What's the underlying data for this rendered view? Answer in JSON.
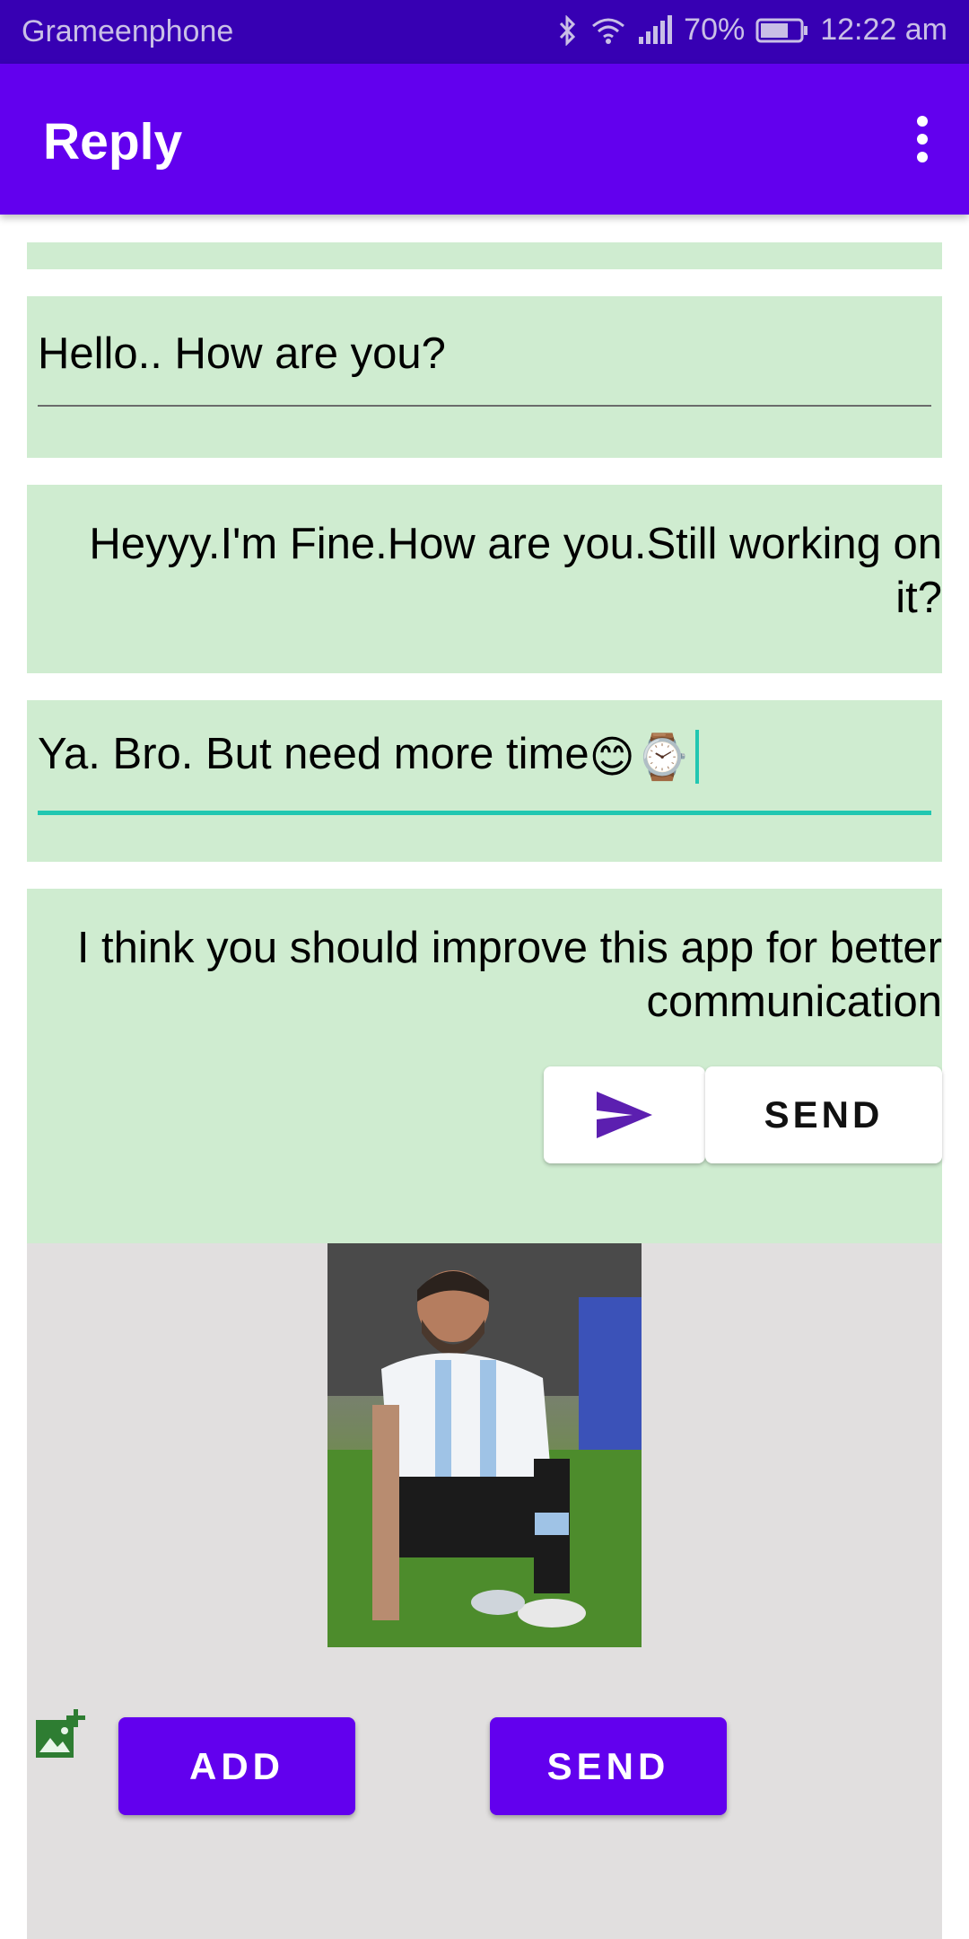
{
  "status_bar": {
    "carrier": "Grameenphone",
    "battery": "70%",
    "time": "12:22 am"
  },
  "app_bar": {
    "title": "Reply"
  },
  "messages": {
    "input1_value": "Hello.. How are you?",
    "reply1": "Heyyy.I'm Fine.How are you.Still working on it?",
    "input2_value": "Ya. Bro. But need more time",
    "input2_emojis": "😊⌚",
    "reply2": "I think you should improve this app for better communication"
  },
  "send_row": {
    "send_label": "SEND"
  },
  "image_section": {
    "add_label": "ADD",
    "send_label": "SEND"
  },
  "colors": {
    "status_bar": "#3700b3",
    "app_bar": "#6200ee",
    "card_bg": "#cfecd0",
    "accent": "#21c7b1",
    "image_section_bg": "#e1dfdf"
  },
  "icons": [
    "bluetooth-icon",
    "wifi-icon",
    "signal-icon",
    "battery-icon",
    "overflow-menu-icon",
    "send-arrow-icon",
    "add-image-icon"
  ]
}
